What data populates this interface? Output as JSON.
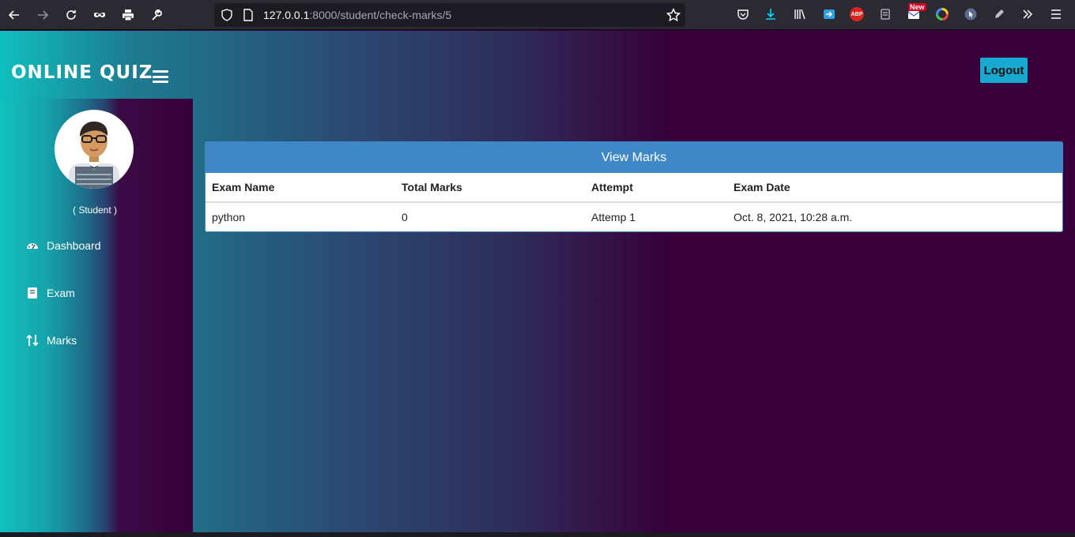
{
  "browser": {
    "url_host": "127.0.0.1",
    "url_rest": ":8000/student/check-marks/5",
    "new_badge": "New",
    "abp_label": "ABP"
  },
  "header": {
    "brand": "ONLINE QUIZ",
    "logout_label": "Logout"
  },
  "sidebar": {
    "role": "( Student )",
    "items": [
      {
        "label": "Dashboard",
        "icon": "dashboard-icon"
      },
      {
        "label": "Exam",
        "icon": "book-icon"
      },
      {
        "label": "Marks",
        "icon": "sort-icon"
      }
    ]
  },
  "marks_panel": {
    "title": "View Marks",
    "columns": [
      "Exam Name",
      "Total Marks",
      "Attempt",
      "Exam Date"
    ],
    "rows": [
      [
        "python",
        "0",
        "Attemp 1",
        "Oct. 8, 2021, 10:28 a.m."
      ]
    ]
  },
  "colors": {
    "panel_heading": "#3f87c7",
    "logout_button": "#17a9cf",
    "page_bg": "#38003a",
    "sidebar_accent": "#12c1bf"
  }
}
